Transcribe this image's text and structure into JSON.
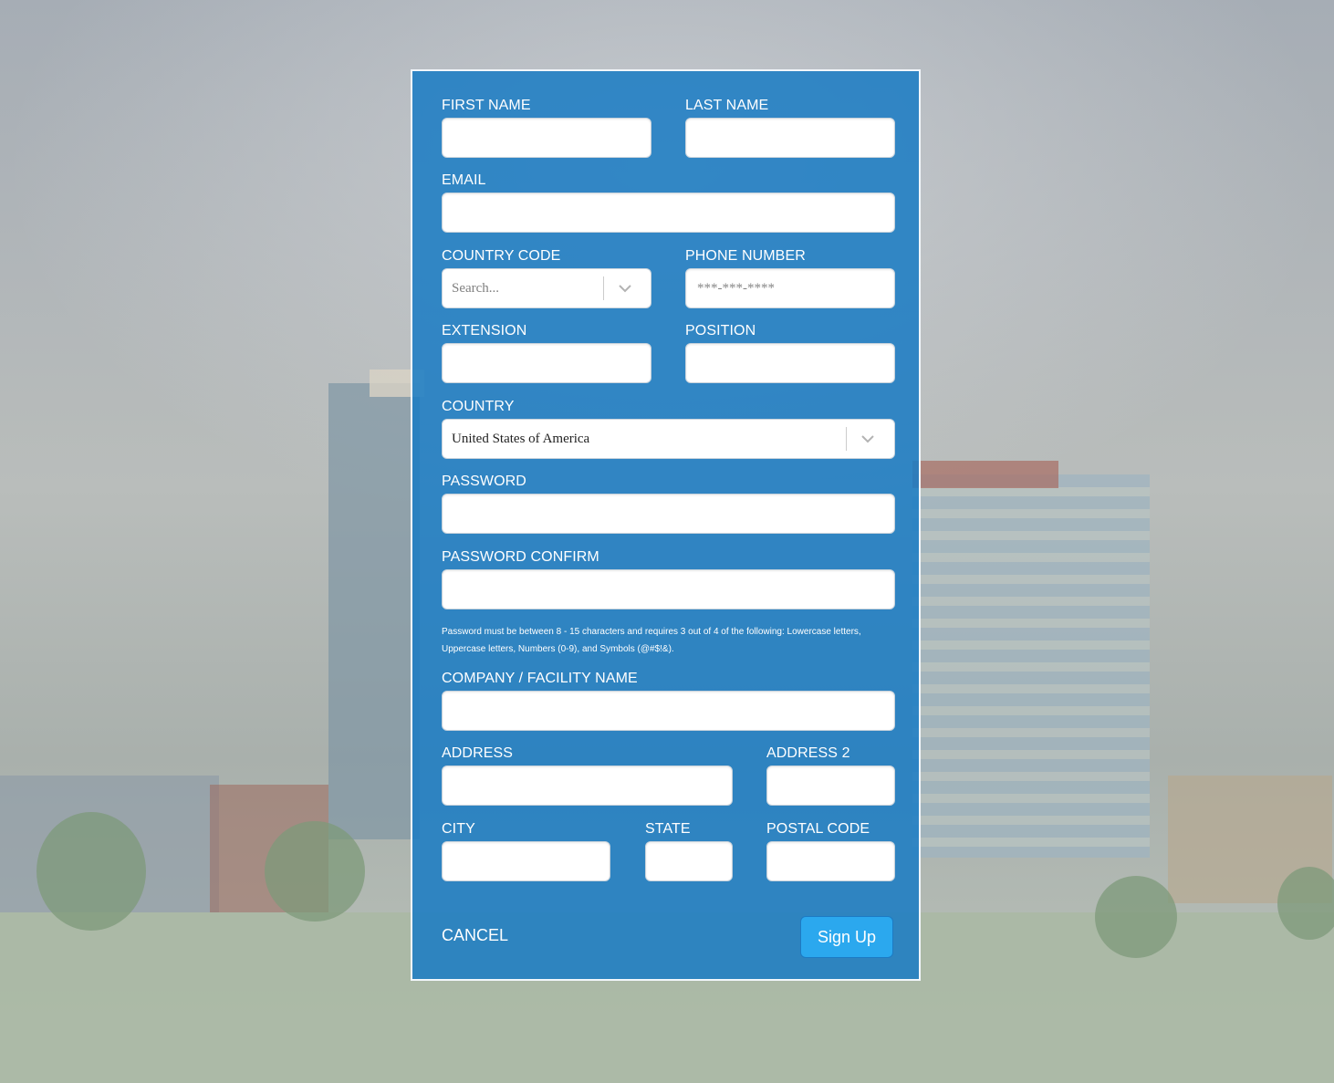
{
  "form": {
    "first_name": {
      "label": "FIRST NAME",
      "value": ""
    },
    "last_name": {
      "label": "LAST NAME",
      "value": ""
    },
    "email": {
      "label": "EMAIL",
      "value": ""
    },
    "country_code": {
      "label": "COUNTRY CODE",
      "placeholder": "Search..."
    },
    "phone_number": {
      "label": "PHONE NUMBER",
      "placeholder": "***-***-****"
    },
    "extension": {
      "label": "EXTENSION",
      "value": ""
    },
    "position": {
      "label": "POSITION",
      "value": ""
    },
    "country": {
      "label": "COUNTRY",
      "value": "United States of America"
    },
    "password": {
      "label": "PASSWORD",
      "value": ""
    },
    "password_confirm": {
      "label": "PASSWORD CONFIRM",
      "value": ""
    },
    "password_hint": "Password must be between 8 - 15 characters and requires 3 out of 4 of the following: Lowercase letters, Uppercase letters, Numbers (0-9), and Symbols (@#$!&).",
    "company": {
      "label": "COMPANY / FACILITY NAME",
      "value": ""
    },
    "address": {
      "label": "ADDRESS",
      "value": ""
    },
    "address2": {
      "label": "ADDRESS 2",
      "value": ""
    },
    "city": {
      "label": "CITY",
      "value": ""
    },
    "state": {
      "label": "STATE",
      "value": ""
    },
    "postal_code": {
      "label": "POSTAL CODE",
      "value": ""
    }
  },
  "actions": {
    "cancel_label": "CANCEL",
    "signup_label": "Sign Up"
  },
  "icons": {
    "dropdown": "chevron-down-icon"
  },
  "colors": {
    "panel": "#1a7cc4",
    "button": "#2ba8ee",
    "label": "#ffffff"
  }
}
